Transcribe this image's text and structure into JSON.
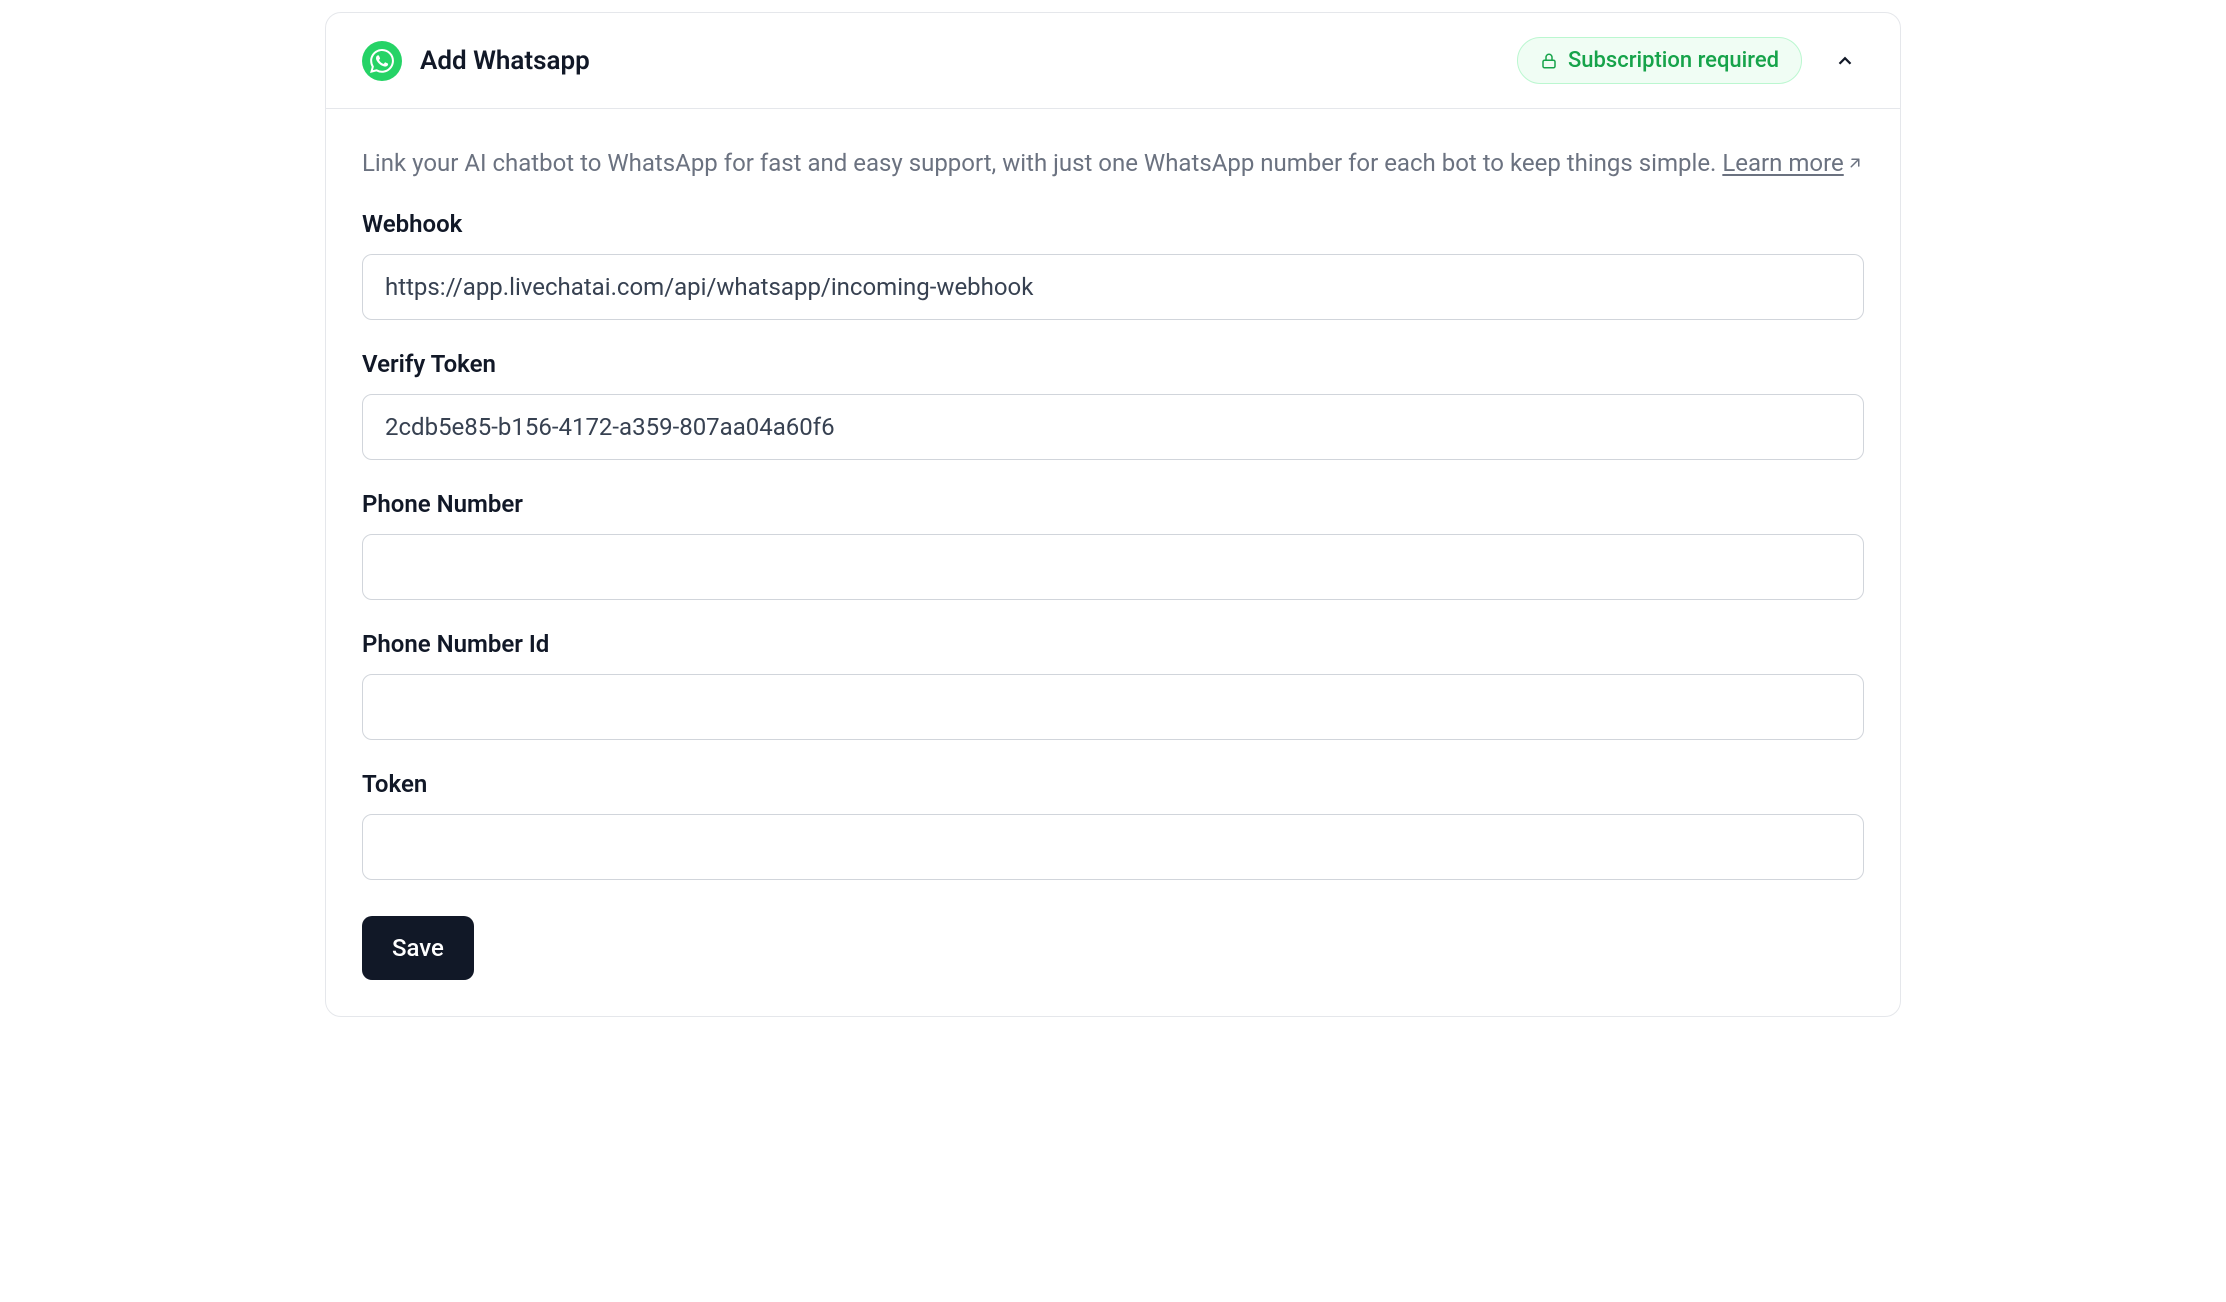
{
  "header": {
    "title": "Add Whatsapp",
    "badge_label": "Subscription required"
  },
  "description": {
    "text": "Link your AI chatbot to WhatsApp for fast and easy support, with just one WhatsApp number for each bot to keep things simple. ",
    "learn_more_label": "Learn more"
  },
  "form": {
    "webhook": {
      "label": "Webhook",
      "value": "https://app.livechatai.com/api/whatsapp/incoming-webhook"
    },
    "verify_token": {
      "label": "Verify Token",
      "value": "2cdb5e85-b156-4172-a359-807aa04a60f6"
    },
    "phone_number": {
      "label": "Phone Number",
      "value": ""
    },
    "phone_number_id": {
      "label": "Phone Number Id",
      "value": ""
    },
    "token": {
      "label": "Token",
      "value": ""
    },
    "save_label": "Save"
  }
}
